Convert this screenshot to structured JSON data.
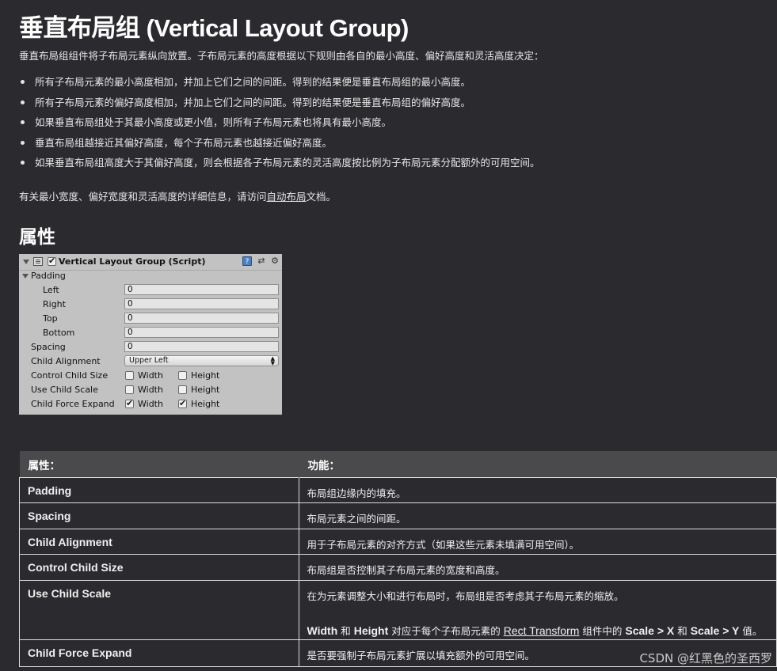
{
  "title": "垂直布局组 (Vertical Layout Group)",
  "intro": "垂直布局组组件将子布局元素纵向放置。子布局元素的高度根据以下规则由各自的最小高度、偏好高度和灵活高度决定：",
  "rules": [
    "所有子布局元素的最小高度相加，并加上它们之间的间距。得到的结果便是垂直布局组的最小高度。",
    "所有子布局元素的偏好高度相加，并加上它们之间的间距。得到的结果便是垂直布局组的偏好高度。",
    "如果垂直布局组处于其最小高度或更小值，则所有子布局元素也将具有最小高度。",
    "垂直布局组越接近其偏好高度，每个子布局元素也越接近偏好高度。",
    "如果垂直布局组高度大于其偏好高度，则会根据各子布局元素的灵活高度按比例为子布局元素分配额外的可用空间。"
  ],
  "more_info": {
    "prefix": "有关最小宽度、偏好宽度和灵活高度的详细信息，请访问",
    "link": "自动布局",
    "suffix": "文档。"
  },
  "properties_heading": "属性",
  "inspector": {
    "component_title": "Vertical Layout Group (Script)",
    "component_enabled": true,
    "padding_label": "Padding",
    "left_label": "Left",
    "left_value": "0",
    "right_label": "Right",
    "right_value": "0",
    "top_label": "Top",
    "top_value": "0",
    "bottom_label": "Bottom",
    "bottom_value": "0",
    "spacing_label": "Spacing",
    "spacing_value": "0",
    "child_alignment_label": "Child Alignment",
    "child_alignment_value": "Upper Left",
    "control_child_size_label": "Control Child Size",
    "use_child_scale_label": "Use Child Scale",
    "child_force_expand_label": "Child Force Expand",
    "width_label": "Width",
    "height_label": "Height",
    "control_child_size": {
      "width": false,
      "height": false
    },
    "use_child_scale": {
      "width": false,
      "height": false
    },
    "child_force_expand": {
      "width": true,
      "height": true
    },
    "icons": [
      "help-book-icon",
      "preset-icon",
      "settings-gear-icon"
    ]
  },
  "table": {
    "headers": [
      "属性：",
      "功能："
    ],
    "rows": [
      {
        "name": "Padding",
        "desc": "布局组边缘内的填充。"
      },
      {
        "name": "Spacing",
        "desc": "布局元素之间的间距。"
      },
      {
        "name": "Child Alignment",
        "desc": "用于子布局元素的对齐方式（如果这些元素未填满可用空间）。"
      },
      {
        "name": "Control Child Size",
        "desc": "布局组是否控制其子布局元素的宽度和高度。"
      },
      {
        "name": "Use Child Scale",
        "desc": "在为元素调整大小和进行布局时，布局组是否考虑其子布局元素的缩放。"
      },
      {
        "name": "Child Force Expand",
        "desc": "是否要强制子布局元素扩展以填充额外的可用空间。"
      }
    ],
    "scale_note": {
      "width": "Width",
      "and1": " 和 ",
      "height": "Height",
      "mid": " 对应于每个子布局元素的 ",
      "rect": "Rect Transform",
      "mid2": " 组件中的 ",
      "scalex": "Scale > X",
      "and2": " 和 ",
      "scaley": "Scale > Y",
      "end": " 值。"
    }
  },
  "watermark": "CSDN @红黑色的圣西罗"
}
